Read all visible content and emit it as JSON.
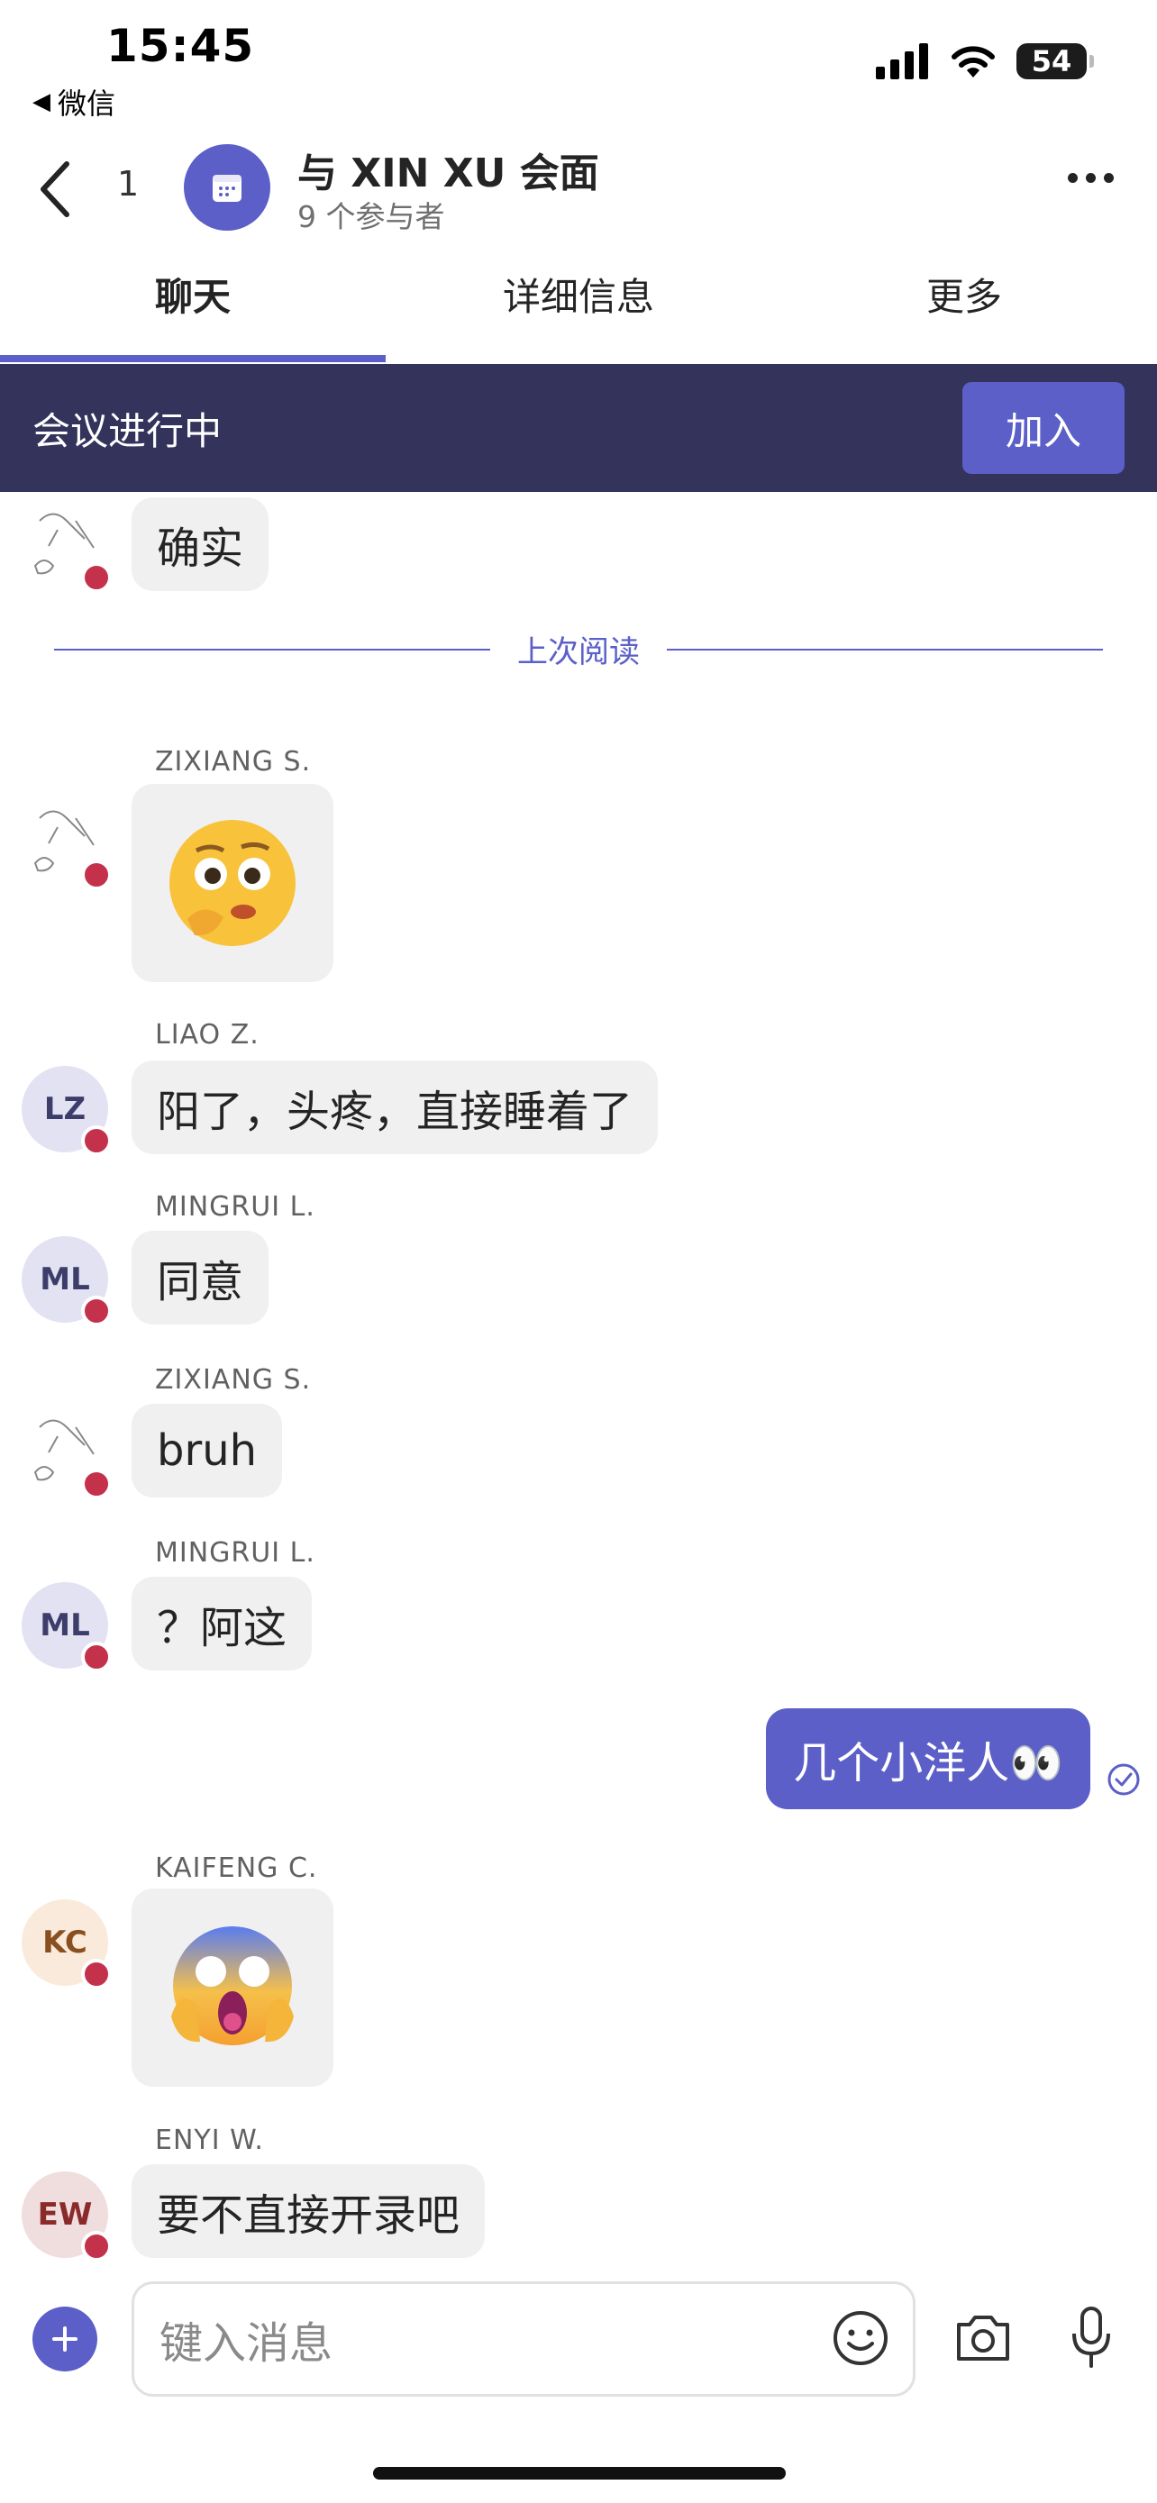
{
  "status_bar": {
    "time": "15:45",
    "back_app": "微信",
    "battery": "54"
  },
  "header": {
    "unread_count": "1",
    "title": "与 XIN XU 会面",
    "subtitle": "9 个参与者"
  },
  "tabs": [
    {
      "label": "聊天",
      "active": true
    },
    {
      "label": "详细信息",
      "active": false
    },
    {
      "label": "更多",
      "active": false
    }
  ],
  "banner": {
    "text": "会议进行中",
    "join_label": "加入"
  },
  "chat": {
    "divider_label": "上次阅读",
    "messages": [
      {
        "sender": "",
        "text": "确实"
      },
      {
        "sender": "ZIXIANG S.",
        "text": "🫢"
      },
      {
        "sender": "LIAO Z.",
        "initials": "LZ",
        "text": "阳了，头疼，直接睡着了"
      },
      {
        "sender": "MINGRUI L.",
        "initials": "ML",
        "text": "同意"
      },
      {
        "sender": "ZIXIANG S.",
        "text": "bruh"
      },
      {
        "sender": "MINGRUI L.",
        "initials": "ML",
        "text": "？阿这"
      },
      {
        "sender": "me",
        "text": "几个小洋人👀"
      },
      {
        "sender": "KAIFENG C.",
        "initials": "KC",
        "text": "😱"
      },
      {
        "sender": "ENYI W.",
        "initials": "EW",
        "text": "要不直接开录吧"
      }
    ]
  },
  "composer": {
    "placeholder": "键入消息"
  },
  "colors": {
    "accent": "#5b5fc7",
    "banner": "#33335c",
    "presence_busy": "#c4314b"
  }
}
